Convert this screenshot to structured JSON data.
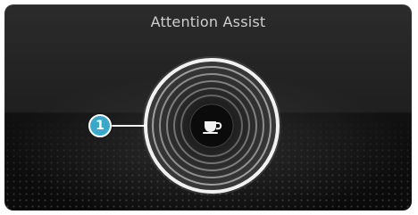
{
  "screen": {
    "title": "Attention Assist"
  },
  "callout": {
    "label": "1",
    "color": "#39a9c9"
  },
  "gauge": {
    "center_icon": "coffee-cup-icon",
    "ring_color": "#e8e8e8"
  }
}
